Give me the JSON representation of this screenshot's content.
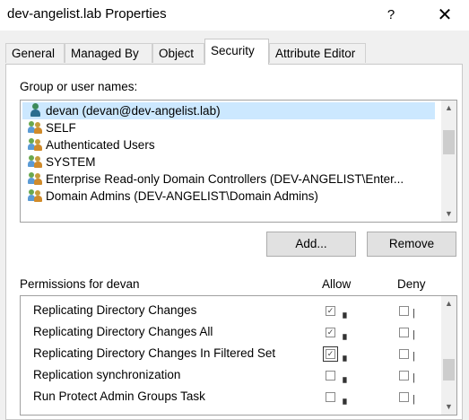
{
  "window": {
    "title": "dev-angelist.lab Properties",
    "help_glyph": "?",
    "close_glyph": "✕"
  },
  "tabs": [
    {
      "label": "General",
      "active": false
    },
    {
      "label": "Managed By",
      "active": false
    },
    {
      "label": "Object",
      "active": false
    },
    {
      "label": "Security",
      "active": true
    },
    {
      "label": "Attribute Editor",
      "active": false
    }
  ],
  "security": {
    "group_label": "Group or user names:",
    "principals": [
      {
        "name": "devan (devan@dev-angelist.lab)",
        "icon": "user-icon",
        "selected": true
      },
      {
        "name": "SELF",
        "icon": "group-icon",
        "selected": false
      },
      {
        "name": "Authenticated Users",
        "icon": "group-icon",
        "selected": false
      },
      {
        "name": "SYSTEM",
        "icon": "group-icon",
        "selected": false
      },
      {
        "name": "Enterprise Read-only Domain Controllers (DEV-ANGELIST\\Enter...",
        "icon": "group-icon",
        "selected": false
      },
      {
        "name": "Domain Admins (DEV-ANGELIST\\Domain Admins)",
        "icon": "group-icon",
        "selected": false
      }
    ],
    "add_button": "Add...",
    "remove_button": "Remove",
    "permissions_label": "Permissions for devan",
    "allow_header": "Allow",
    "deny_header": "Deny",
    "permissions": [
      {
        "name": "Replicating Directory Changes",
        "allow": true,
        "deny": false
      },
      {
        "name": "Replicating Directory Changes All",
        "allow": true,
        "deny": false
      },
      {
        "name": "Replicating Directory Changes In Filtered Set",
        "allow": true,
        "deny": false
      },
      {
        "name": "Replication synchronization",
        "allow": false,
        "deny": false
      },
      {
        "name": "Run Protect Admin Groups Task",
        "allow": false,
        "deny": false
      }
    ]
  },
  "scroll_arrows": {
    "up": "▲",
    "down": "▼"
  },
  "colors": {
    "selection": "#cce8ff",
    "panel": "#ffffff",
    "window_bg": "#f0f0f0"
  }
}
